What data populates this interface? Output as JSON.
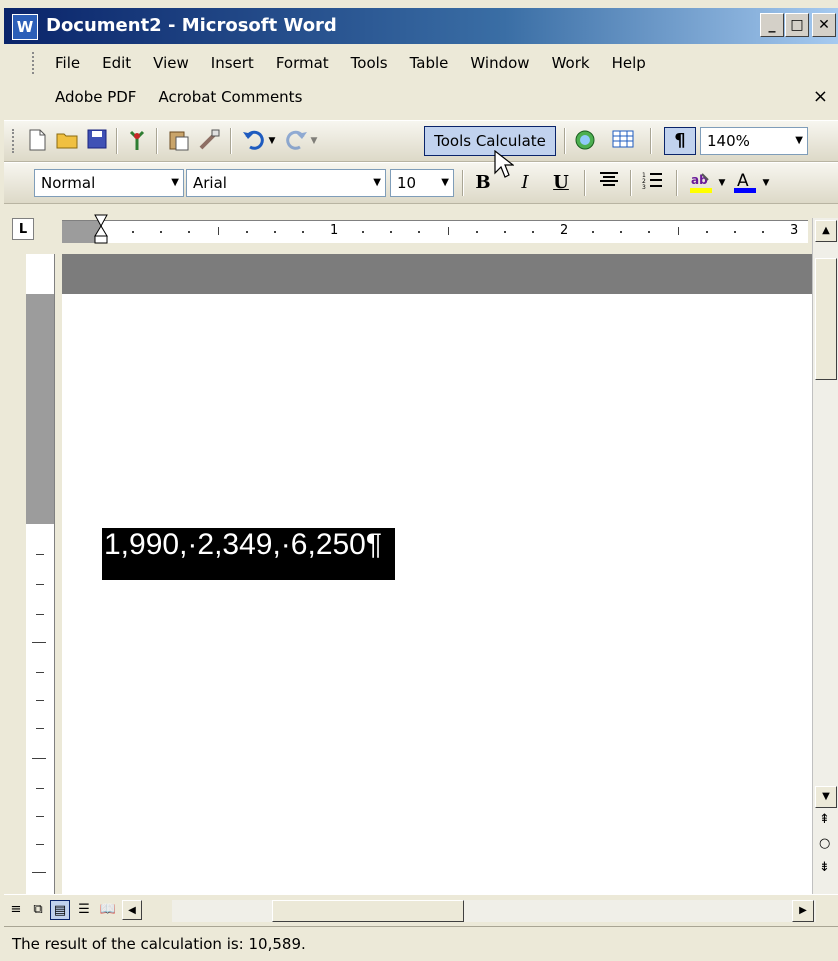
{
  "window": {
    "title": "Document2 - Microsoft Word",
    "app_icon": "W",
    "controls": [
      "minimize-icon",
      "maximize-icon",
      "close-icon"
    ]
  },
  "menu": {
    "row1": [
      "File",
      "Edit",
      "View",
      "Insert",
      "Format",
      "Tools",
      "Table",
      "Window",
      "Work",
      "Help"
    ],
    "row2": [
      "Adobe PDF",
      "Acrobat Comments"
    ],
    "close_glyph": "×"
  },
  "standard_toolbar": {
    "icons": [
      "new-document-icon",
      "open-folder-icon",
      "save-icon",
      "research-icon",
      "paste-icon",
      "format-painter-icon",
      "undo-icon",
      "redo-icon"
    ],
    "custom_button": "Tools Calculate",
    "right_icons": [
      "hyperlink-icon",
      "table-icon"
    ],
    "pilcrow": "¶",
    "zoom": "140%"
  },
  "formatting_toolbar": {
    "style": "Normal",
    "font": "Arial",
    "size": "10",
    "bold": "B",
    "italic": "I",
    "underline": "U",
    "highlight_color": "#ffff00",
    "font_color": "#0000ff"
  },
  "ruler": {
    "corner": "L",
    "numbers": [
      "1",
      "2",
      "3"
    ]
  },
  "document": {
    "selected_text": "1,990,·2,349,·6,250¶"
  },
  "statusbar": {
    "message": "The result of the calculation is: 10,589."
  }
}
